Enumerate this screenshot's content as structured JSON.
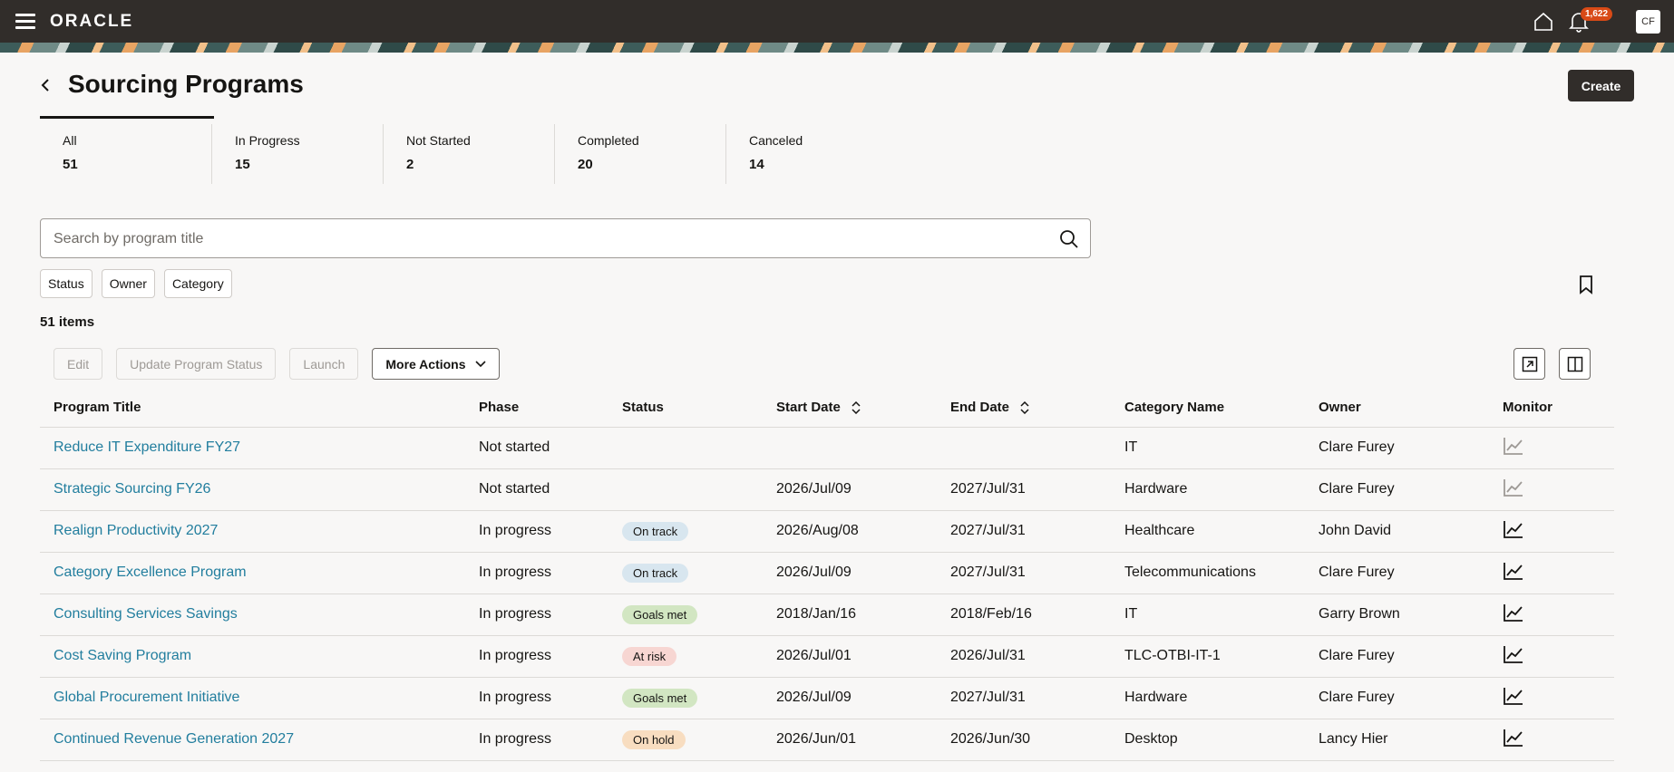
{
  "header": {
    "logo": "ORACLE",
    "notifications_count": "1,622",
    "avatar_initials": "CF"
  },
  "page": {
    "title": "Sourcing Programs",
    "create_label": "Create"
  },
  "stats": [
    {
      "label": "All",
      "count": "51"
    },
    {
      "label": "In Progress",
      "count": "15"
    },
    {
      "label": "Not Started",
      "count": "2"
    },
    {
      "label": "Completed",
      "count": "20"
    },
    {
      "label": "Canceled",
      "count": "14"
    }
  ],
  "search": {
    "placeholder": "Search by program title"
  },
  "filters": [
    "Status",
    "Owner",
    "Category"
  ],
  "item_count": "51 items",
  "toolbar": {
    "edit": "Edit",
    "update_status": "Update Program Status",
    "launch": "Launch",
    "more_actions": "More Actions"
  },
  "table": {
    "headers": [
      "Program Title",
      "Phase",
      "Status",
      "Start Date",
      "End Date",
      "Category Name",
      "Owner",
      "Monitor"
    ],
    "rows": [
      {
        "title": "Reduce IT Expenditure FY27",
        "phase": "Not started",
        "status": "",
        "status_type": "",
        "start": "",
        "end": "",
        "category": "IT",
        "owner": "Clare Furey",
        "monitor_active": false
      },
      {
        "title": "Strategic Sourcing FY26",
        "phase": "Not started",
        "status": "",
        "status_type": "",
        "start": "2026/Jul/09",
        "end": "2027/Jul/31",
        "category": "Hardware",
        "owner": "Clare Furey",
        "monitor_active": false
      },
      {
        "title": "Realign Productivity 2027",
        "phase": "In progress",
        "status": "On track",
        "status_type": "on-track",
        "start": "2026/Aug/08",
        "end": "2027/Jul/31",
        "category": "Healthcare",
        "owner": "John David",
        "monitor_active": true
      },
      {
        "title": "Category Excellence Program",
        "phase": "In progress",
        "status": "On track",
        "status_type": "on-track",
        "start": "2026/Jul/09",
        "end": "2027/Jul/31",
        "category": "Telecommunications",
        "owner": "Clare Furey",
        "monitor_active": true
      },
      {
        "title": "Consulting Services Savings",
        "phase": "In progress",
        "status": "Goals met",
        "status_type": "goals-met",
        "start": "2018/Jan/16",
        "end": "2018/Feb/16",
        "category": "IT",
        "owner": "Garry Brown",
        "monitor_active": true
      },
      {
        "title": "Cost Saving Program",
        "phase": "In progress",
        "status": "At risk",
        "status_type": "at-risk",
        "start": "2026/Jul/01",
        "end": "2026/Jul/31",
        "category": "TLC-OTBI-IT-1",
        "owner": "Clare Furey",
        "monitor_active": true
      },
      {
        "title": "Global Procurement Initiative",
        "phase": "In progress",
        "status": "Goals met",
        "status_type": "goals-met",
        "start": "2026/Jul/09",
        "end": "2027/Jul/31",
        "category": "Hardware",
        "owner": "Clare Furey",
        "monitor_active": true
      },
      {
        "title": "Continued Revenue Generation 2027",
        "phase": "In progress",
        "status": "On hold",
        "status_type": "on-hold",
        "start": "2026/Jun/01",
        "end": "2026/Jun/30",
        "category": "Desktop",
        "owner": "Lancy Hier",
        "monitor_active": true
      }
    ]
  }
}
